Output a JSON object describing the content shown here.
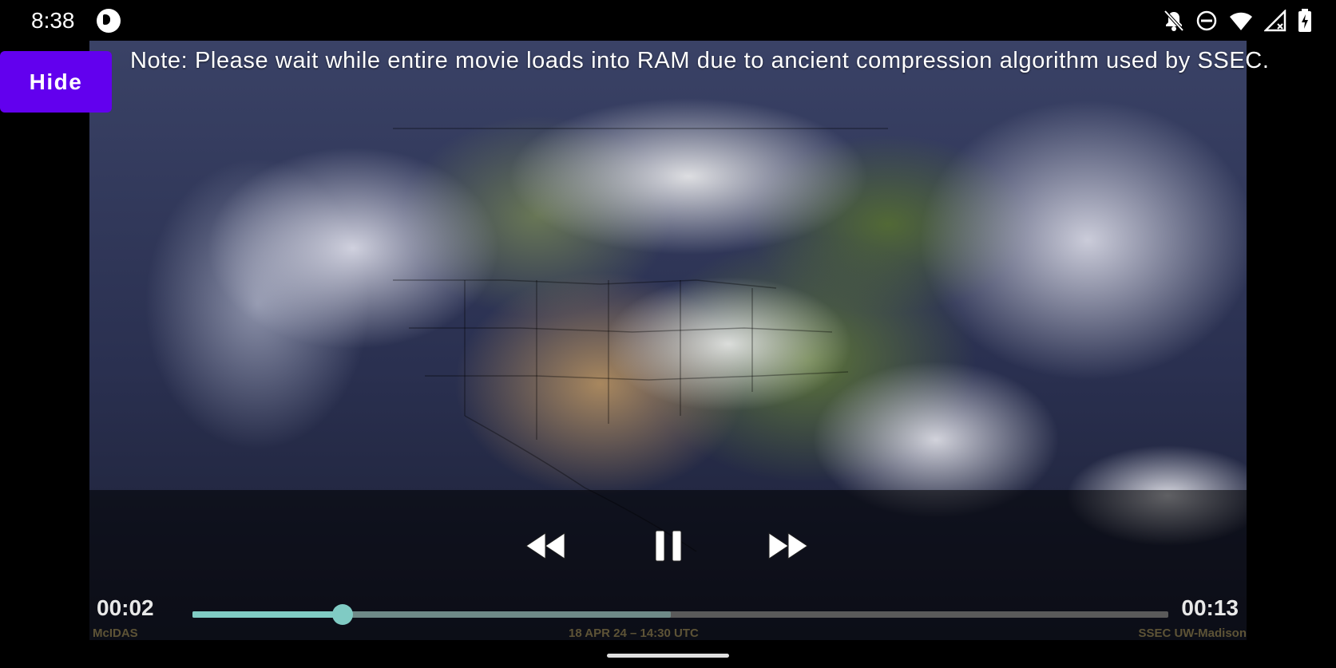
{
  "status_bar": {
    "time": "8:38",
    "icons": [
      "app-notification-icon",
      "notifications-off-icon",
      "do-not-disturb-icon",
      "wifi-icon",
      "signal-off-icon",
      "battery-charging-icon"
    ]
  },
  "note": "Note: Please wait while entire movie loads into RAM due to ancient compression algorithm used by SSEC.",
  "hide_button": {
    "label": "Hide"
  },
  "player": {
    "current_time": "00:02",
    "duration": "00:13",
    "progress": 0.154,
    "buffered": 0.49,
    "controls": [
      "rewind-icon",
      "pause-icon",
      "fast-forward-icon"
    ]
  },
  "video_overlay": {
    "left_label": "McIDAS",
    "center_label": "18 APR 24 – 14:30 UTC",
    "right_label": "SSEC UW-Madison"
  },
  "colors": {
    "accent": "#6200ee",
    "seek": "#80cbc4"
  }
}
